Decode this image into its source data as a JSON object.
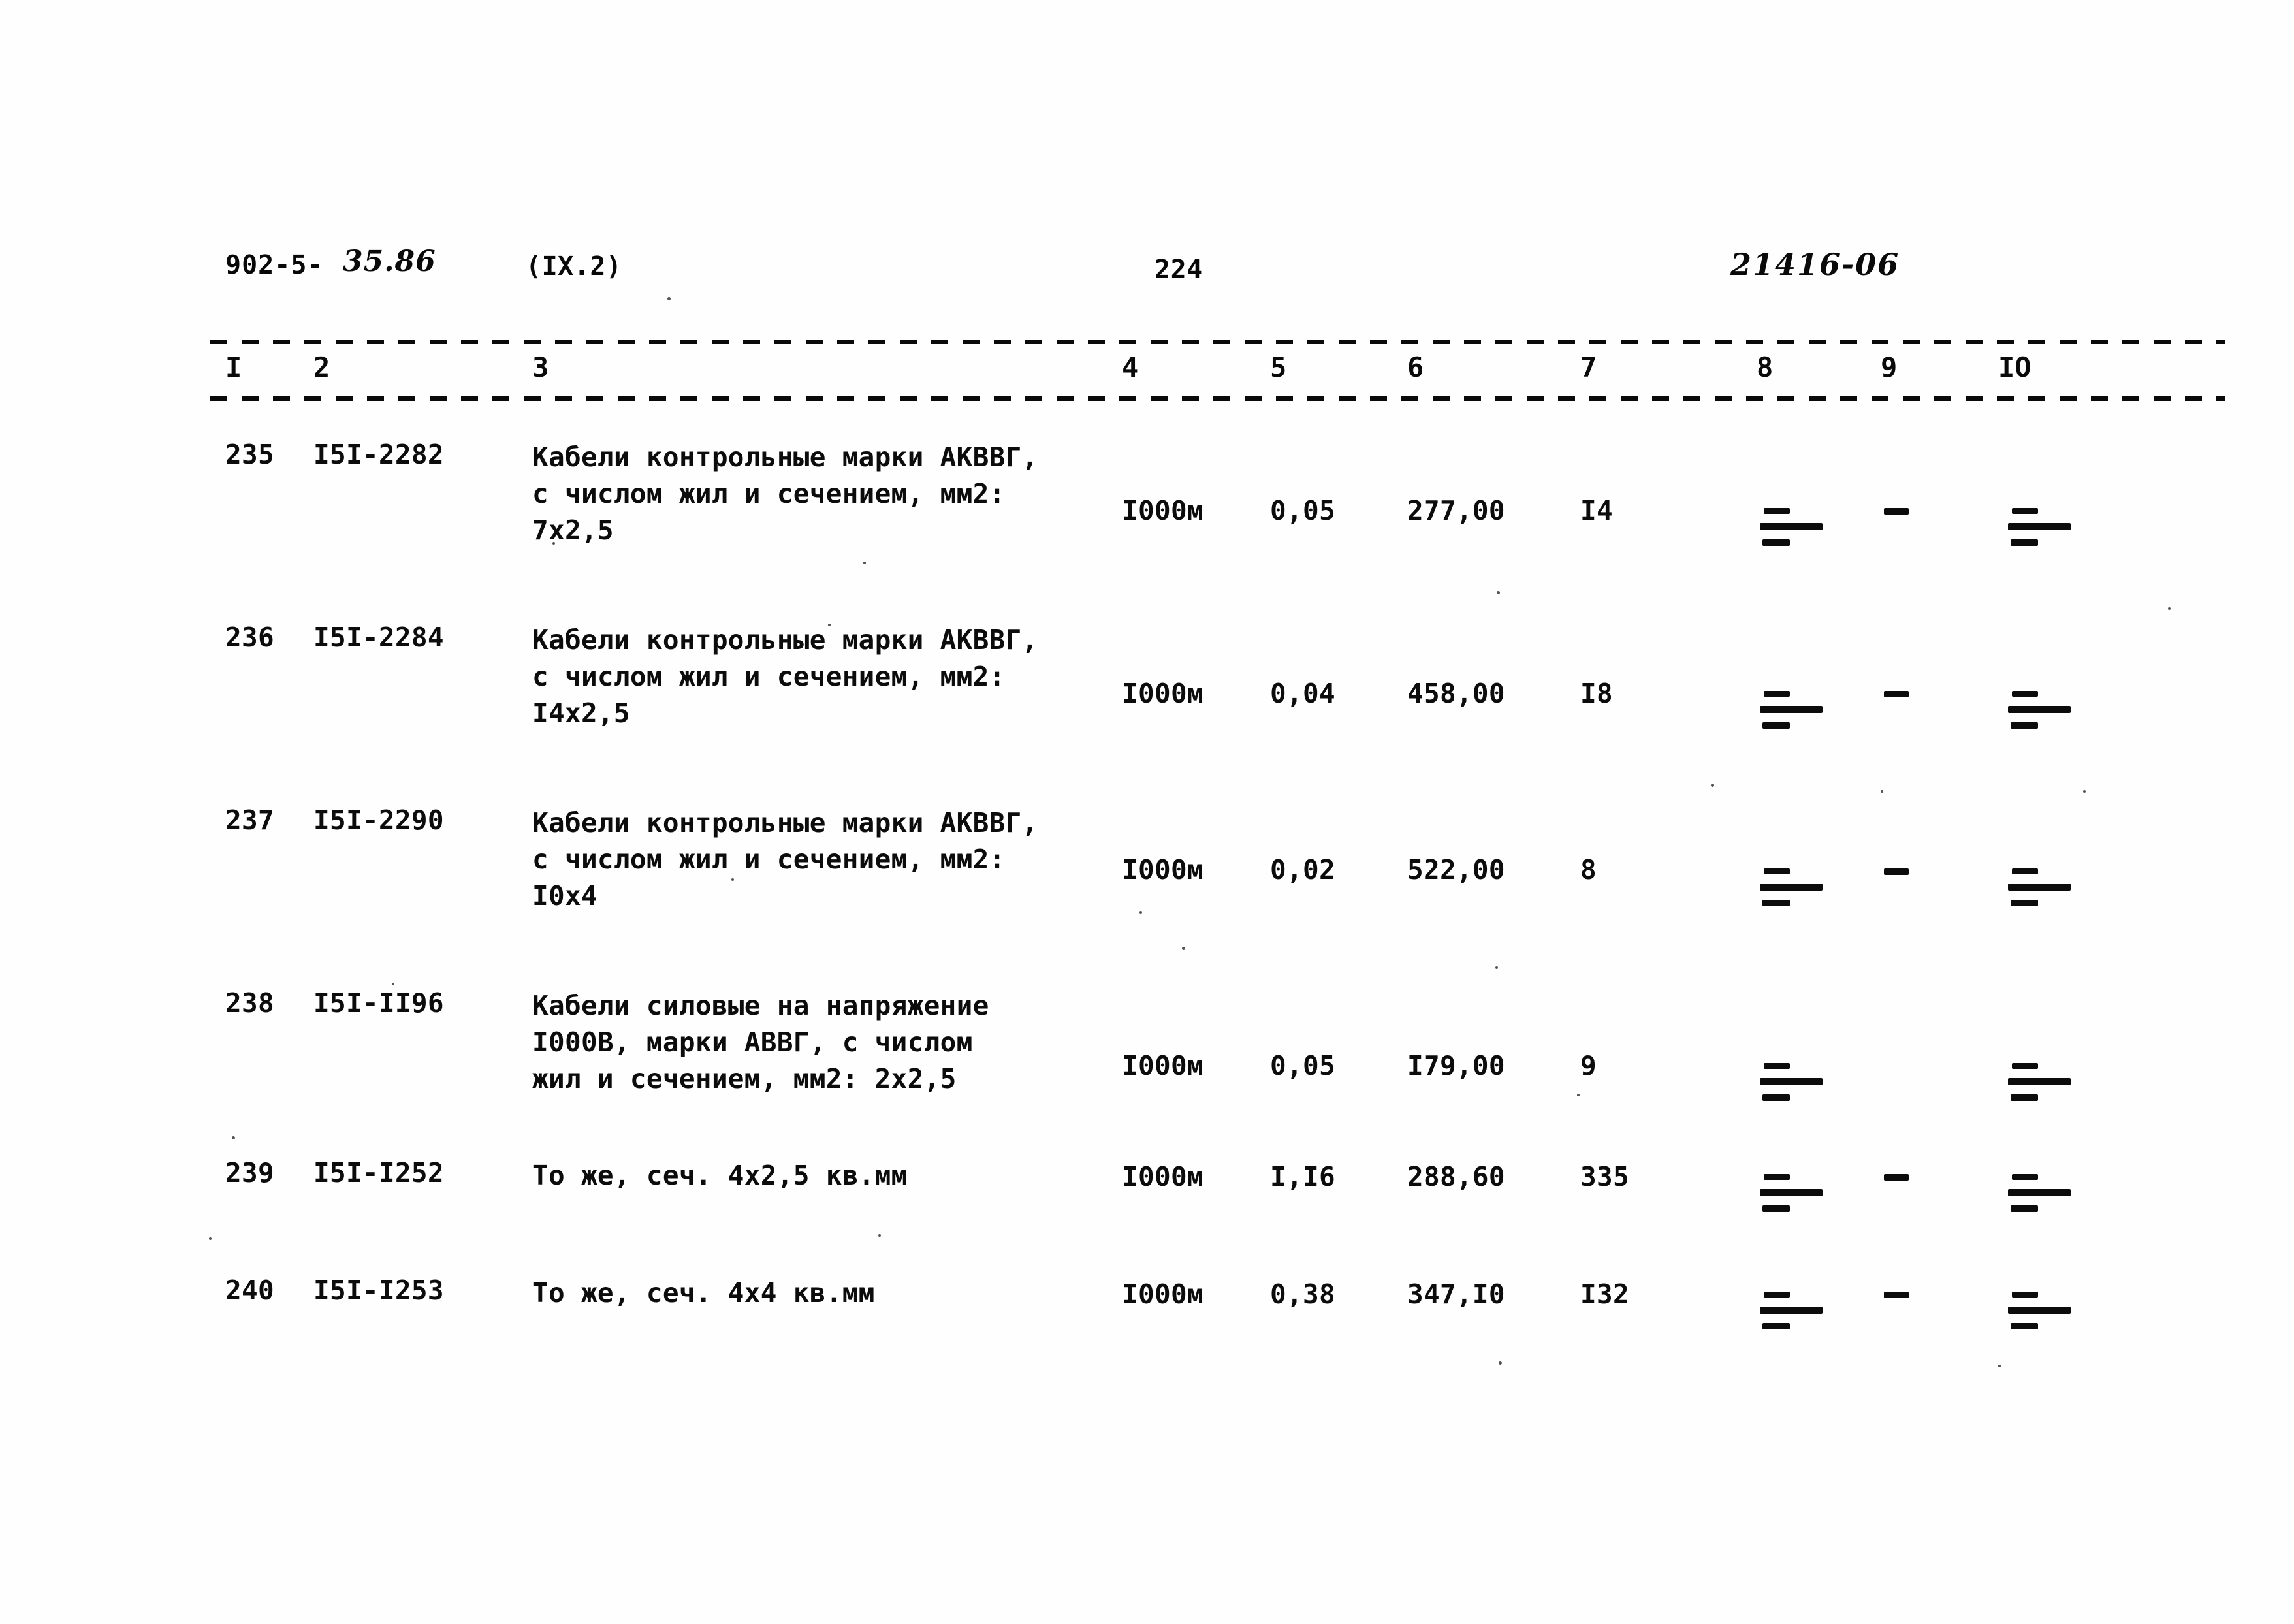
{
  "header": {
    "doc_code": "902-5-",
    "doc_code_handwritten": "35.86",
    "section_ref": "(IX.2)",
    "page_number": "224",
    "archive_code": "21416-06"
  },
  "table": {
    "column_headers": [
      "I",
      "2",
      "3",
      "4",
      "5",
      "6",
      "7",
      "8",
      "9",
      "IO"
    ],
    "rows": [
      {
        "num": "235",
        "code": "I5I-2282",
        "description": "Кабели контрольные марки АКВВГ,\nс числом жил и сечением, мм2:\n7x2,5",
        "unit": "I000м",
        "qty": "0,05",
        "price": "277,00",
        "mass": "I4",
        "col8": "dash-group",
        "col9": "dash",
        "col10": "dash-group"
      },
      {
        "num": "236",
        "code": "I5I-2284",
        "description": "Кабели контрольные марки АКВВГ,\nс числом жил и сечением, мм2:\nI4x2,5",
        "unit": "I000м",
        "qty": "0,04",
        "price": "458,00",
        "mass": "I8",
        "col8": "dash-group",
        "col9": "dash",
        "col10": "dash-group"
      },
      {
        "num": "237",
        "code": "I5I-2290",
        "description": "Кабели контрольные марки АКВВГ,\nс числом жил и сечением, мм2:\nI0x4",
        "unit": "I000м",
        "qty": "0,02",
        "price": "522,00",
        "mass": "8",
        "col8": "dash-group",
        "col9": "dash",
        "col10": "dash-group"
      },
      {
        "num": "238",
        "code": "I5I-II96",
        "description": "Кабели силовые на напряжение\nI000В, марки АВВГ, с числом\nжил и сечением, мм2: 2x2,5",
        "unit": "I000м",
        "qty": "0,05",
        "price": "I79,00",
        "mass": "9",
        "col8": "dash-group",
        "col9": "",
        "col10": "dash-group"
      },
      {
        "num": "239",
        "code": "I5I-I252",
        "description": "То же, сеч. 4x2,5 кв.мм",
        "unit": "I000м",
        "qty": "I,I6",
        "price": "288,60",
        "mass": "335",
        "col8": "dash-group",
        "col9": "dash",
        "col10": "dash-group"
      },
      {
        "num": "240",
        "code": "I5I-I253",
        "description": "То же, сеч. 4x4 кв.мм",
        "unit": "I000м",
        "qty": "0,38",
        "price": "347,I0",
        "mass": "I32",
        "col8": "dash-group",
        "col9": "dash",
        "col10": "dash-group"
      }
    ]
  },
  "layout": {
    "column_header_x": [
      345,
      480,
      815,
      1718,
      1945,
      2155,
      2420,
      2690,
      2880,
      3060
    ],
    "row_tops": [
      672,
      952,
      1232,
      1512,
      1772,
      1952
    ],
    "row_value_tops": [
      758,
      1038,
      1308,
      1608,
      1778,
      1958
    ],
    "row_dash_tops": [
      778,
      1058,
      1330,
      1628,
      1798,
      1978
    ]
  },
  "colors": {
    "ink": "#0c0c0c",
    "paper": "#fefefe"
  }
}
